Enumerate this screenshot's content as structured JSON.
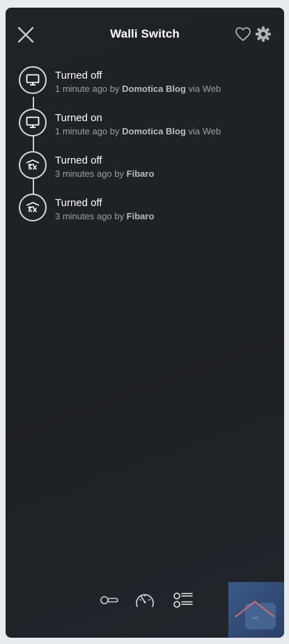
{
  "header": {
    "title": "Walli Switch",
    "icons": {
      "close": "close-icon",
      "favorite": "heart-icon",
      "settings": "gear-icon"
    }
  },
  "colors": {
    "panel_bg": "#1f2327",
    "title": "#ffffff",
    "meta": "#9aa0a6",
    "timeline": "#c9ccd0",
    "thumb": "#3a5a86",
    "thumb_roof": "#e56b6b"
  },
  "events": [
    {
      "status": "Turned off",
      "time": "1 minute ago",
      "by": "by",
      "user": "Domotica Blog",
      "via": "via Web",
      "icon": "monitor-icon"
    },
    {
      "status": "Turned on",
      "time": "1 minute ago",
      "by": "by",
      "user": "Domotica Blog",
      "via": "via Web",
      "icon": "monitor-icon"
    },
    {
      "status": "Turned off",
      "time": "3 minutes ago",
      "by": "by",
      "user": "Fibaro",
      "via": "",
      "icon": "fibaro-logo-icon"
    },
    {
      "status": "Turned off",
      "time": "3 minutes ago",
      "by": "by",
      "user": "Fibaro",
      "via": "",
      "icon": "fibaro-logo-icon"
    }
  ],
  "bottom_nav": [
    {
      "name": "control",
      "icon": "toggle-switch-icon"
    },
    {
      "name": "energy",
      "icon": "gauge-icon"
    },
    {
      "name": "history",
      "icon": "list-icon"
    }
  ]
}
